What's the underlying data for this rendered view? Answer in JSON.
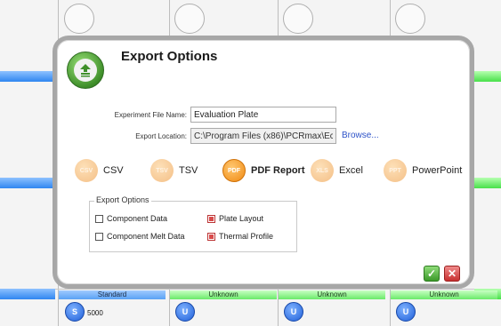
{
  "dialog": {
    "title": "Export Options",
    "logo_icon": "export-icon",
    "experiment_label": "Experiment File Name:",
    "experiment_value": "Evaluation Plate",
    "location_label": "Export Location:",
    "location_value": "C:\\Program Files (x86)\\PCRmax\\Eco\\",
    "browse_label": "Browse...",
    "formats": [
      {
        "icon_text": "CSV",
        "label": "CSV",
        "selected": false
      },
      {
        "icon_text": "TSV",
        "label": "TSV",
        "selected": false
      },
      {
        "icon_text": "PDF",
        "label": "PDF Report",
        "selected": true
      },
      {
        "icon_text": "XLS",
        "label": "Excel",
        "selected": false
      },
      {
        "icon_text": "PPT",
        "label": "PowerPoint",
        "selected": false
      }
    ],
    "options_group_title": "Export Options",
    "options": [
      {
        "label": "Component Data",
        "checked": false
      },
      {
        "label": "Plate Layout",
        "checked": true
      },
      {
        "label": "Component Melt Data",
        "checked": false
      },
      {
        "label": "Thermal Profile",
        "checked": true
      }
    ],
    "ok_icon": "check-icon",
    "cancel_icon": "close-icon",
    "ok_glyph": "✓",
    "cancel_glyph": "✕"
  },
  "plate": {
    "cells": [
      {
        "label": "Standard",
        "badge": "S",
        "value": "5000"
      },
      {
        "label": "Unknown",
        "badge": "U",
        "value": ""
      },
      {
        "label": "Unknown",
        "badge": "U",
        "value": ""
      },
      {
        "label": "Unknown",
        "badge": "U",
        "value": ""
      }
    ],
    "colors": {
      "standard": "#5aa2f4",
      "unknown": "#6aea6a"
    }
  }
}
